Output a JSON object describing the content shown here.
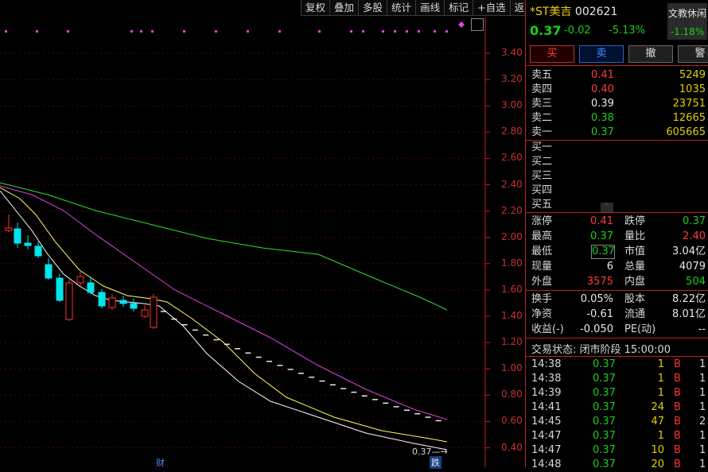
{
  "toolbar": [
    "复权",
    "叠加",
    "多股",
    "统计",
    "画线",
    "标记",
    "+自选",
    "返回"
  ],
  "chart": {
    "price_axis": [
      "3.40",
      "3.20",
      "3.00",
      "2.80",
      "2.60",
      "2.40",
      "2.20",
      "2.00",
      "1.80",
      "1.60",
      "1.40",
      "1.20",
      "1.00",
      "0.80",
      "0.60",
      "0.40"
    ],
    "markers": {
      "cai": "财",
      "die": "跌",
      "last": "0.37"
    },
    "colors": {
      "ma5": "#ffffff",
      "ma10": "#ffff60",
      "ma20": "#e040e0",
      "ma60": "#30e030",
      "up": "#ff3030",
      "down": "#00e5ee"
    }
  },
  "stock": {
    "name": "*ST美吉",
    "code": "002621",
    "price": "0.37",
    "change": "-0.02",
    "pct": "-5.13%"
  },
  "widget": {
    "title": "文教休闲",
    "pct": "-1.18%"
  },
  "trade_buttons": {
    "buy": "买",
    "sell": "卖",
    "cancel": "撤",
    "alert": "警"
  },
  "asks": [
    {
      "label": "卖五",
      "price": "0.41",
      "vol": "5249"
    },
    {
      "label": "卖四",
      "price": "0.40",
      "vol": "1035"
    },
    {
      "label": "卖三",
      "price": "0.39",
      "vol": "23751"
    },
    {
      "label": "卖二",
      "price": "0.38",
      "vol": "12665"
    },
    {
      "label": "卖一",
      "price": "0.37",
      "vol": "605665"
    }
  ],
  "bids": [
    {
      "label": "买一",
      "price": "",
      "vol": ""
    },
    {
      "label": "买二",
      "price": "",
      "vol": ""
    },
    {
      "label": "买三",
      "price": "",
      "vol": ""
    },
    {
      "label": "买四",
      "price": "",
      "vol": ""
    },
    {
      "label": "买五",
      "price": "",
      "vol": ""
    }
  ],
  "stats1": [
    {
      "k1": "涨停",
      "v1": "0.41",
      "k2": "跌停",
      "v2": "0.37"
    },
    {
      "k1": "最高",
      "v1": "0.37",
      "k2": "量比",
      "v2": "2.40"
    },
    {
      "k1": "最低",
      "v1": "0.37",
      "k2": "市值",
      "v2": "3.04亿"
    },
    {
      "k1": "现量",
      "v1": "6",
      "k2": "总量",
      "v2": "4079"
    },
    {
      "k1": "外盘",
      "v1": "3575",
      "k2": "内盘",
      "v2": "504"
    }
  ],
  "stats2": [
    {
      "k1": "换手",
      "v1": "0.05%",
      "k2": "股本",
      "v2": "8.22亿"
    },
    {
      "k1": "净资",
      "v1": "-0.61",
      "k2": "流通",
      "v2": "8.01亿"
    },
    {
      "k1": "收益(-)",
      "v1": "-0.050",
      "k2": "PE(动)",
      "v2": "--"
    }
  ],
  "status": "交易状态: 闭市阶段 15:00:00",
  "ticks": [
    {
      "time": "14:38",
      "price": "0.37",
      "vol": "1",
      "side": "B",
      "n": "1"
    },
    {
      "time": "14:38",
      "price": "0.37",
      "vol": "1",
      "side": "B",
      "n": "1"
    },
    {
      "time": "14:39",
      "price": "0.37",
      "vol": "1",
      "side": "B",
      "n": "1"
    },
    {
      "time": "14:41",
      "price": "0.37",
      "vol": "24",
      "side": "B",
      "n": "1"
    },
    {
      "time": "14:45",
      "price": "0.37",
      "vol": "47",
      "side": "B",
      "n": "2"
    },
    {
      "time": "14:47",
      "price": "0.37",
      "vol": "1",
      "side": "B",
      "n": "1"
    },
    {
      "time": "14:47",
      "price": "0.37",
      "vol": "10",
      "side": "B",
      "n": "1"
    },
    {
      "time": "14:48",
      "price": "0.37",
      "vol": "20",
      "side": "B",
      "n": "1"
    }
  ]
}
